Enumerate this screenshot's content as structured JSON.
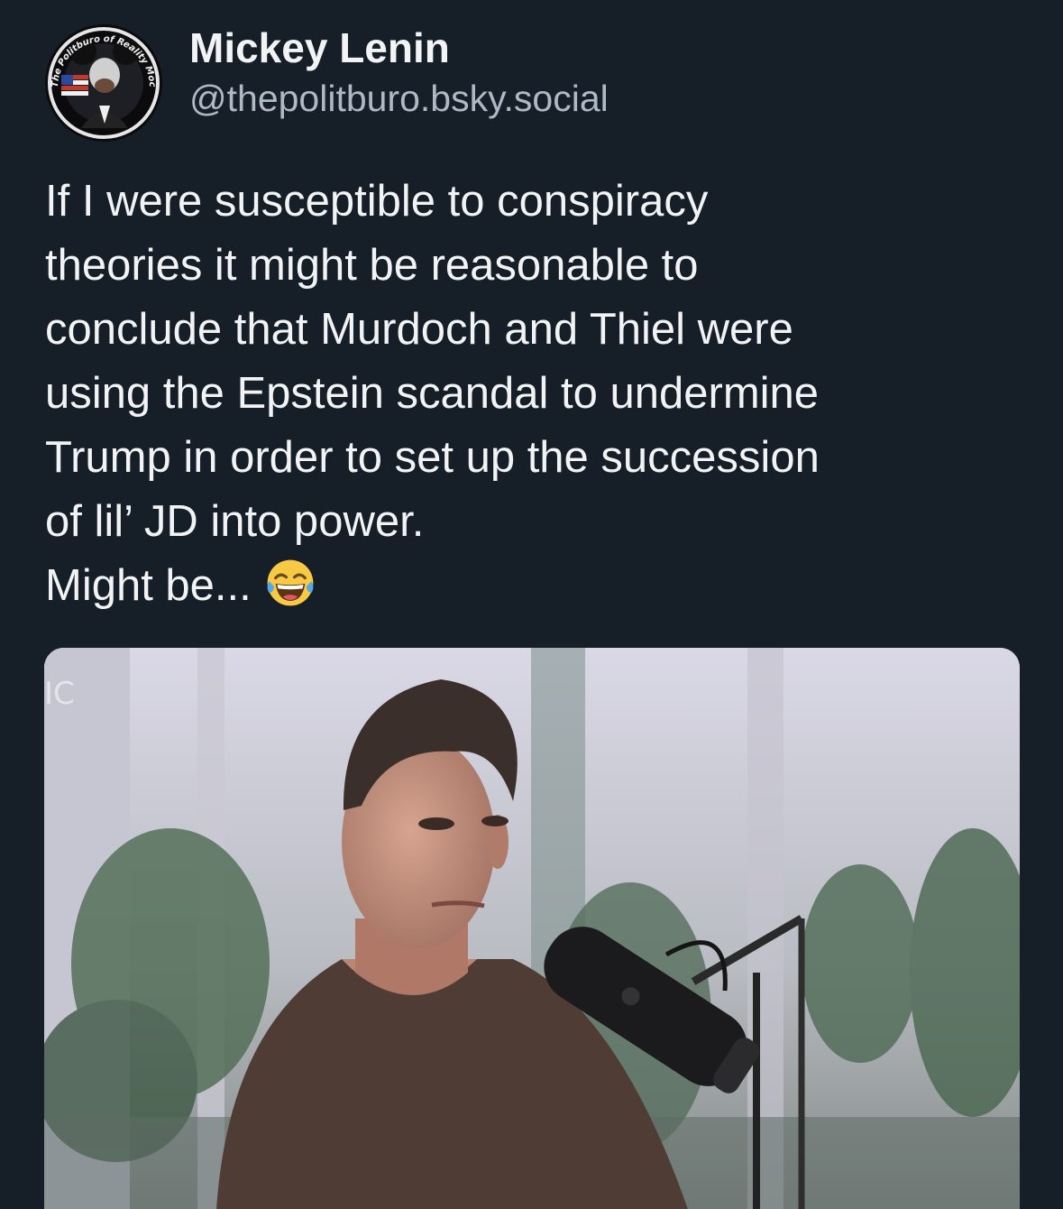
{
  "post": {
    "author": {
      "display_name": "Mickey Lenin",
      "handle": "@thepolitburo.bsky.social",
      "avatar_badge_text": "The Politburo of Reality Mockery"
    },
    "text_lines": [
      "If I were susceptible to conspiracy",
      "theories it might be reasonable to",
      "conclude that Murdoch and Thiel were",
      "using the Epstein scandal to undermine",
      "Trump in order to set up the succession",
      "of lil’ JD into power.",
      "Might be..."
    ],
    "emoji": "face-with-tears-of-joy",
    "media": {
      "type": "video-frame",
      "overlay_text": "IC",
      "subject": "man in brown t-shirt seated at podcast microphone"
    }
  },
  "colors": {
    "background": "#161e27",
    "text_primary": "#f1f3f5",
    "text_secondary": "#aeb9c6",
    "emoji_yellow": "#f7c944",
    "tear_blue": "#56a7e8"
  }
}
